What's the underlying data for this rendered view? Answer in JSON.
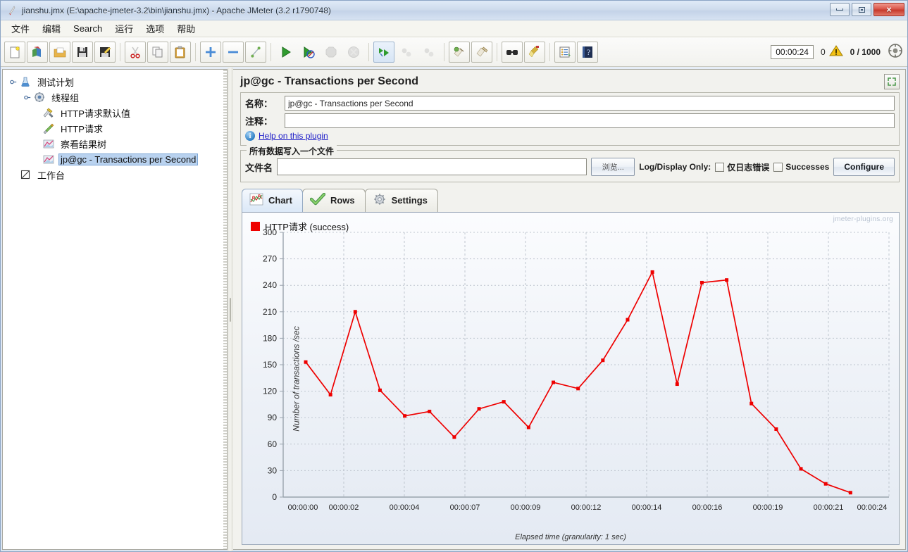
{
  "window": {
    "title": "jianshu.jmx (E:\\apache-jmeter-3.2\\bin\\jianshu.jmx) - Apache JMeter (3.2 r1790748)",
    "app_icon": "jmeter-feather-icon",
    "buttons": {
      "minimize": "minimize-icon",
      "restore": "restore-icon",
      "close": "×"
    }
  },
  "menubar": {
    "items": [
      {
        "label": "文件",
        "name": "menu-file"
      },
      {
        "label": "编辑",
        "name": "menu-edit"
      },
      {
        "label": "Search",
        "name": "menu-search"
      },
      {
        "label": "运行",
        "name": "menu-run"
      },
      {
        "label": "选项",
        "name": "menu-options"
      },
      {
        "label": "帮助",
        "name": "menu-help"
      }
    ]
  },
  "toolbar": {
    "elapsed_time": "00:00:24",
    "warning_count": "0",
    "thread_count": "0 / 1000",
    "buttons": [
      "new-icon",
      "templates-icon",
      "open-icon",
      "save-icon",
      "save-as-icon",
      "cut-icon",
      "copy-icon",
      "paste-icon",
      "expand-all-icon",
      "collapse-all-icon",
      "toggle-icon",
      "start-icon",
      "start-no-timers-icon",
      "stop-icon",
      "shutdown-icon",
      "remote-start-all-icon",
      "remote-stop-all-icon",
      "remote-shutdown-all-icon",
      "clear-icon",
      "clear-all-icon",
      "search-icon",
      "search-reset-icon",
      "function-helper-icon",
      "help-icon"
    ]
  },
  "tree": {
    "nodes": [
      {
        "label": "测试计划",
        "icon": "test-plan-icon",
        "level": 1,
        "selected": false,
        "name": "tree-node-test-plan"
      },
      {
        "label": "线程组",
        "icon": "thread-group-icon",
        "level": 2,
        "selected": false,
        "name": "tree-node-thread-group"
      },
      {
        "label": "HTTP请求默认值",
        "icon": "http-defaults-icon",
        "level": 3,
        "selected": false,
        "name": "tree-node-http-defaults"
      },
      {
        "label": "HTTP请求",
        "icon": "http-request-icon",
        "level": 3,
        "selected": false,
        "name": "tree-node-http-request"
      },
      {
        "label": "察看结果树",
        "icon": "view-results-tree-icon",
        "level": 3,
        "selected": false,
        "name": "tree-node-view-results-tree"
      },
      {
        "label": "jp@gc - Transactions per Second",
        "icon": "tps-listener-icon",
        "level": 3,
        "selected": true,
        "name": "tree-node-tps-listener"
      },
      {
        "label": "工作台",
        "icon": "workbench-icon",
        "level": 1,
        "selected": false,
        "name": "tree-node-workbench"
      }
    ]
  },
  "panel": {
    "title": "jp@gc - Transactions per Second",
    "expand_icon": "expand-panel-icon",
    "name_label": "名称：",
    "name_value": "jp@gc - Transactions per Second",
    "comment_label": "注释：",
    "comment_value": "",
    "help_link": "Help on this plugin",
    "help_icon": "info-icon",
    "file_group_legend": "所有数据写入一个文件",
    "filename_label": "文件名",
    "filename_value": "",
    "browse_button": "浏览...",
    "log_display_label": "Log/Display Only:",
    "checkbox_errors": "仅日志错误",
    "checkbox_errors_checked": false,
    "checkbox_successes": "Successes",
    "checkbox_successes_checked": false,
    "configure_button": "Configure"
  },
  "tabs": [
    {
      "label": "Chart",
      "icon": "chart-icon",
      "active": true,
      "name": "tab-chart"
    },
    {
      "label": "Rows",
      "icon": "checkmark-icon",
      "active": false,
      "name": "tab-rows"
    },
    {
      "label": "Settings",
      "icon": "gear-icon",
      "active": false,
      "name": "tab-settings"
    }
  ],
  "chart_data": {
    "type": "line",
    "title": "",
    "watermark": "jmeter-plugins.org",
    "legend": [
      {
        "name": "HTTP请求 (success)",
        "color": "#ee0000"
      }
    ],
    "legend_position": "top-left",
    "xlabel": "Elapsed time (granularity: 1 sec)",
    "ylabel": "Number of transactions /sec",
    "grid": true,
    "ylim": [
      0,
      300
    ],
    "yticks": [
      0,
      30,
      60,
      90,
      120,
      150,
      180,
      210,
      240,
      270,
      300
    ],
    "xticks": [
      "00:00:00",
      "00:00:02",
      "00:00:04",
      "00:00:07",
      "00:00:09",
      "00:00:12",
      "00:00:14",
      "00:00:16",
      "00:00:19",
      "00:00:21",
      "00:00:24"
    ],
    "x": [
      1,
      2,
      3,
      4,
      5,
      6,
      7,
      8,
      9,
      10,
      11,
      12,
      13,
      14,
      15,
      16,
      17,
      18,
      19,
      20,
      21,
      22,
      23,
      24
    ],
    "series": [
      {
        "name": "HTTP请求 (success)",
        "color": "#ee0000",
        "values": [
          153,
          116,
          210,
          121,
          92,
          97,
          68,
          100,
          108,
          79,
          130,
          123,
          155,
          201,
          255,
          128,
          243,
          246,
          106,
          77,
          32,
          15,
          5
        ]
      }
    ]
  }
}
